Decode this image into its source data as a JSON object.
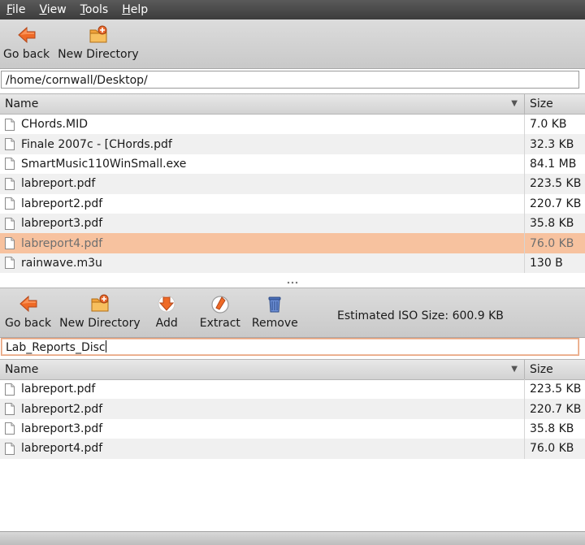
{
  "menu": [
    {
      "accel": "F",
      "rest": "ile"
    },
    {
      "accel": "V",
      "rest": "iew"
    },
    {
      "accel": "T",
      "rest": "ools"
    },
    {
      "accel": "H",
      "rest": "elp"
    }
  ],
  "top_toolbar": {
    "go_back": "Go back",
    "new_directory": "New Directory"
  },
  "path": "/home/cornwall/Desktop/",
  "top_list": {
    "headers": {
      "name": "Name",
      "size": "Size"
    },
    "rows": [
      {
        "name": "CHords.MID",
        "size": "7.0 KB"
      },
      {
        "name": "Finale 2007c - [CHords.pdf",
        "size": "32.3 KB"
      },
      {
        "name": "SmartMusic110WinSmall.exe",
        "size": "84.1 MB"
      },
      {
        "name": "labreport.pdf",
        "size": "223.5 KB"
      },
      {
        "name": "labreport2.pdf",
        "size": "220.7 KB"
      },
      {
        "name": "labreport3.pdf",
        "size": "35.8 KB"
      },
      {
        "name": "labreport4.pdf",
        "size": "76.0 KB"
      },
      {
        "name": "rainwave.m3u",
        "size": "130 B"
      }
    ],
    "selected_row": "labreport4.pdf"
  },
  "bottom_toolbar": {
    "go_back": "Go back",
    "new_directory": "New Directory",
    "add": "Add",
    "extract": "Extract",
    "remove": "Remove",
    "iso_size": "Estimated ISO Size: 600.9 KB"
  },
  "disc_name": "Lab_Reports_Disc",
  "bottom_list": {
    "headers": {
      "name": "Name",
      "size": "Size"
    },
    "rows": [
      {
        "name": "labreport.pdf",
        "size": "223.5 KB"
      },
      {
        "name": "labreport2.pdf",
        "size": "220.7 KB"
      },
      {
        "name": "labreport3.pdf",
        "size": "35.8 KB"
      },
      {
        "name": "labreport4.pdf",
        "size": "76.0 KB"
      }
    ]
  },
  "colors": {
    "selection": "#f7c29f",
    "menubar": "#4a4a4a",
    "accent": "#e8692e"
  }
}
